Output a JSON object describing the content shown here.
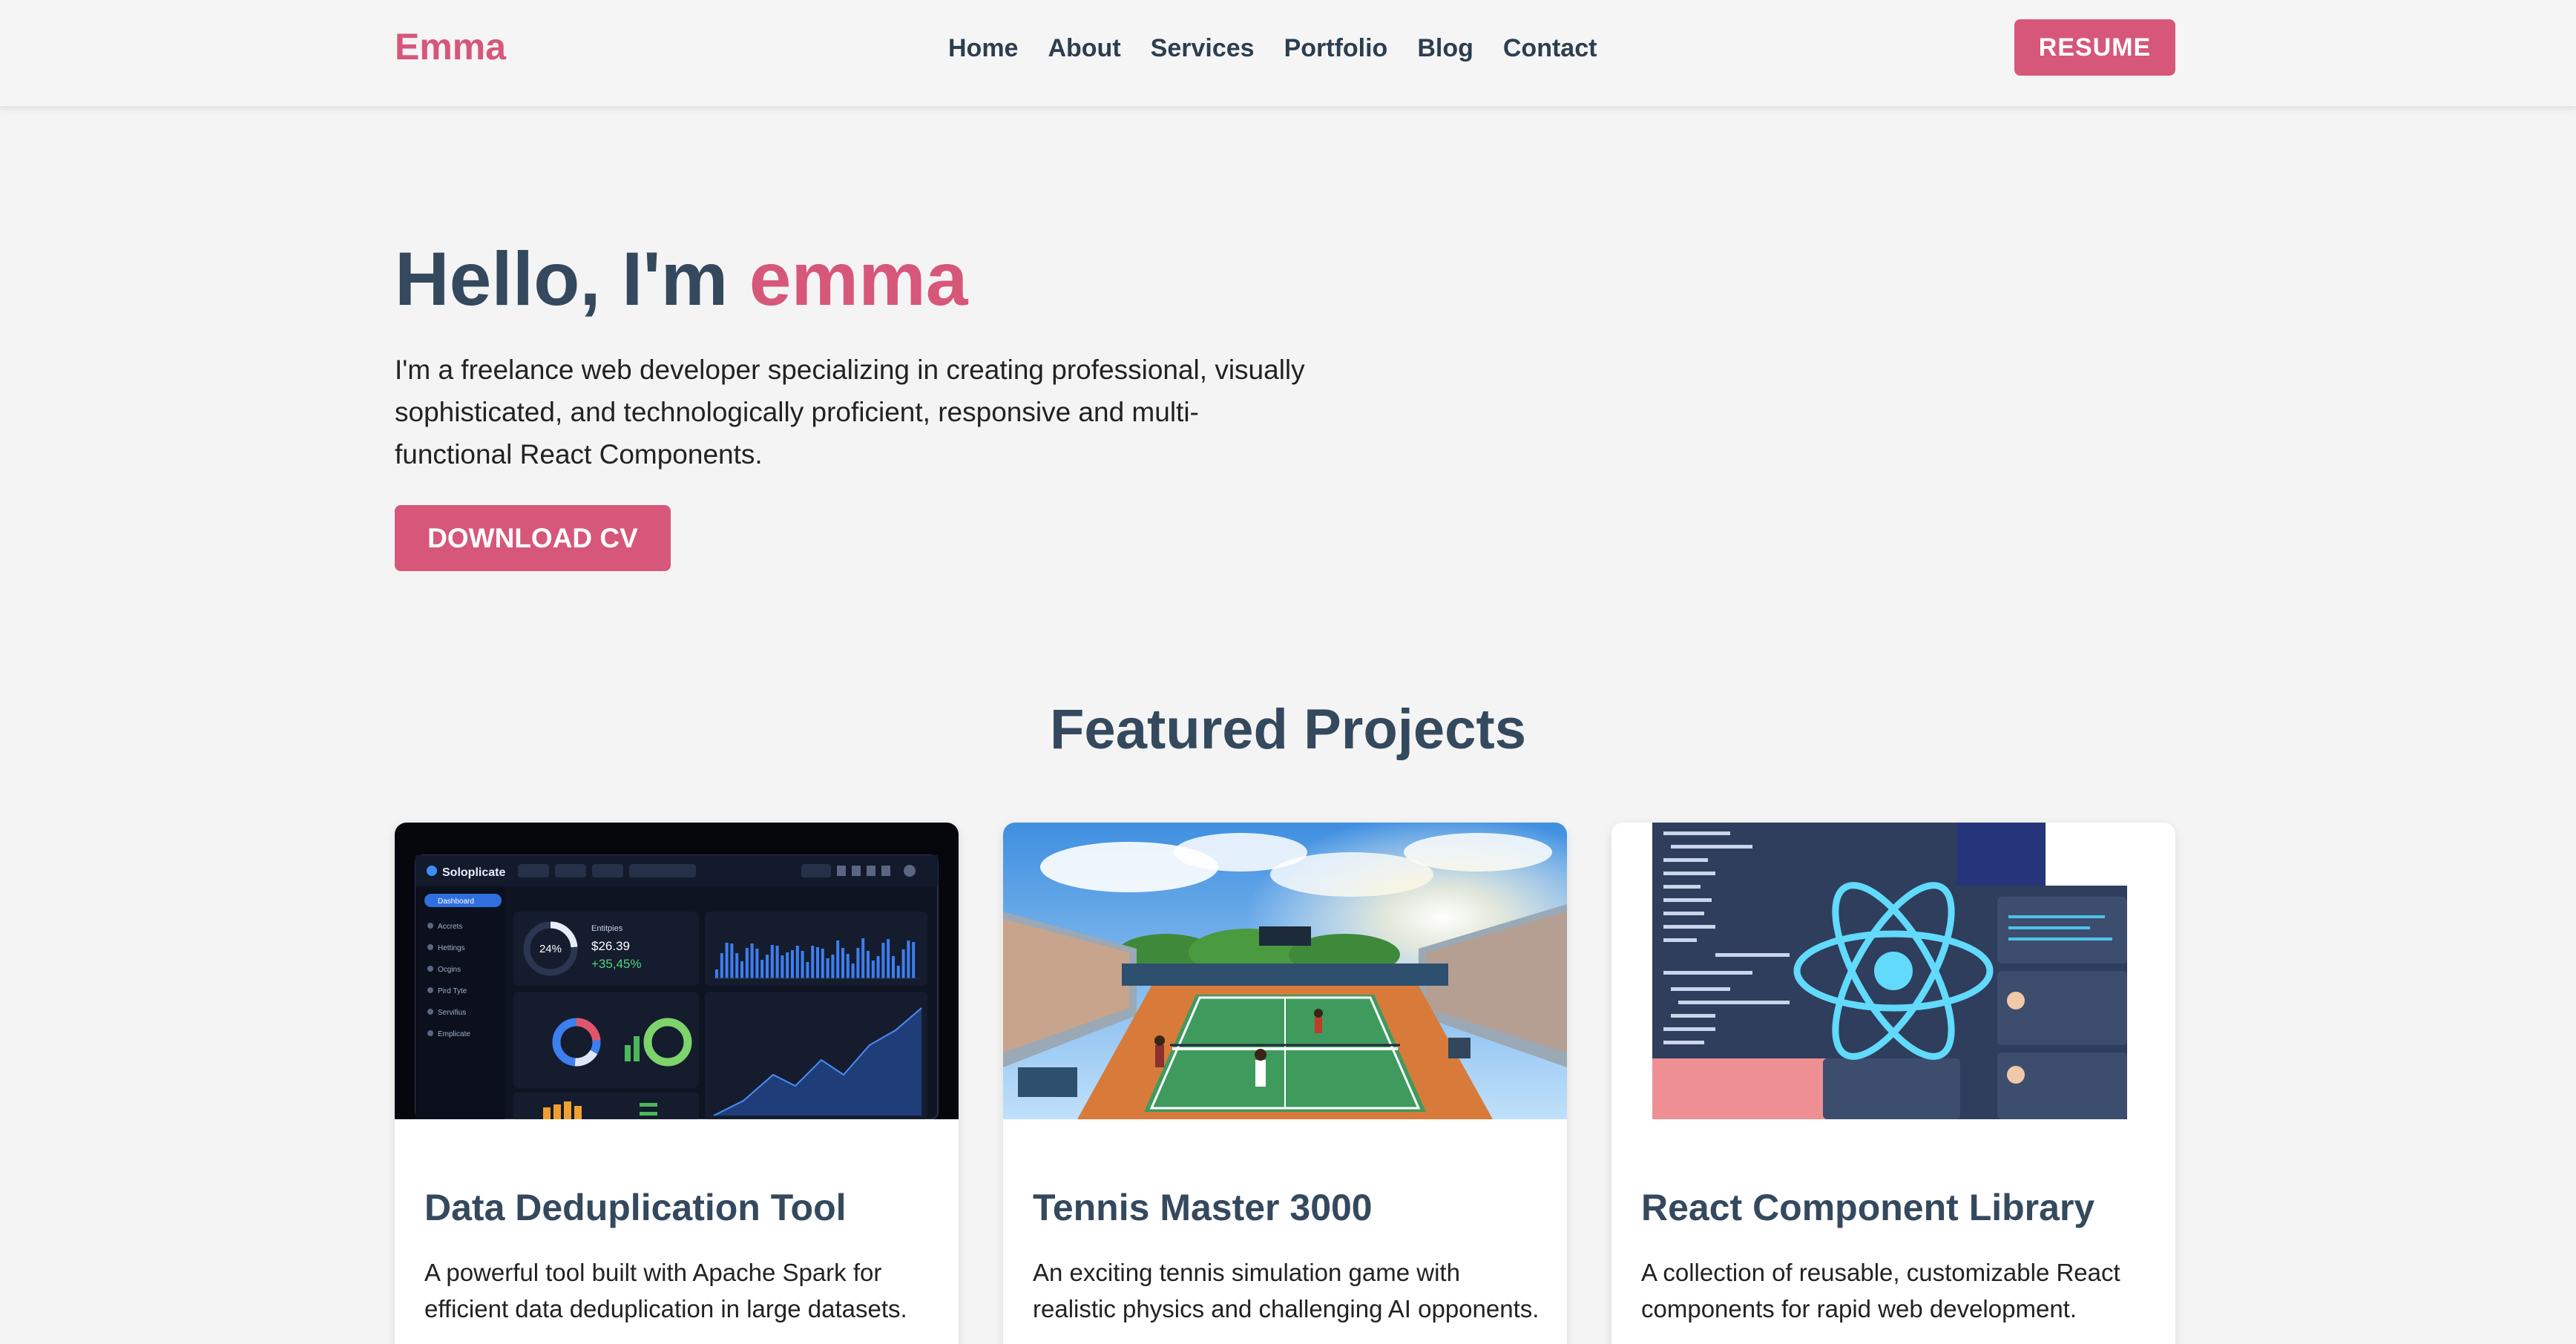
{
  "header": {
    "logo": "Emma",
    "nav": [
      "Home",
      "About",
      "Services",
      "Portfolio",
      "Blog",
      "Contact"
    ],
    "resume_label": "RESUME"
  },
  "hero": {
    "greeting": "Hello, I'm ",
    "name": "emma",
    "description": "I'm a freelance web developer specializing in creating professional, visually sophisticated, and technologically proficient, responsive and multi-functional React Components.",
    "cta_label": "DOWNLOAD CV"
  },
  "projects": {
    "title": "Featured Projects",
    "items": [
      {
        "title": "Data Deduplication Tool",
        "description": "A powerful tool built with Apache Spark for efficient data deduplication in large datasets.",
        "thumb": {
          "app_name": "Soloplicate",
          "percent": "24%",
          "stat_label": "Entitpies",
          "value": "$26.39",
          "change": "+35,45%",
          "menu": [
            "Dashboard",
            "Accrets",
            "Hettings",
            "Ocgins",
            "Pird Tyte",
            "Servifius",
            "Emplicate"
          ]
        }
      },
      {
        "title": "Tennis Master 3000",
        "description": "An exciting tennis simulation game with realistic physics and challenging AI opponents."
      },
      {
        "title": "React Component Library",
        "description": "A collection of reusable, customizable React components for rapid web development."
      }
    ]
  },
  "colors": {
    "accent": "#d6577a",
    "heading": "#34495e",
    "background": "#f4f4f4"
  }
}
